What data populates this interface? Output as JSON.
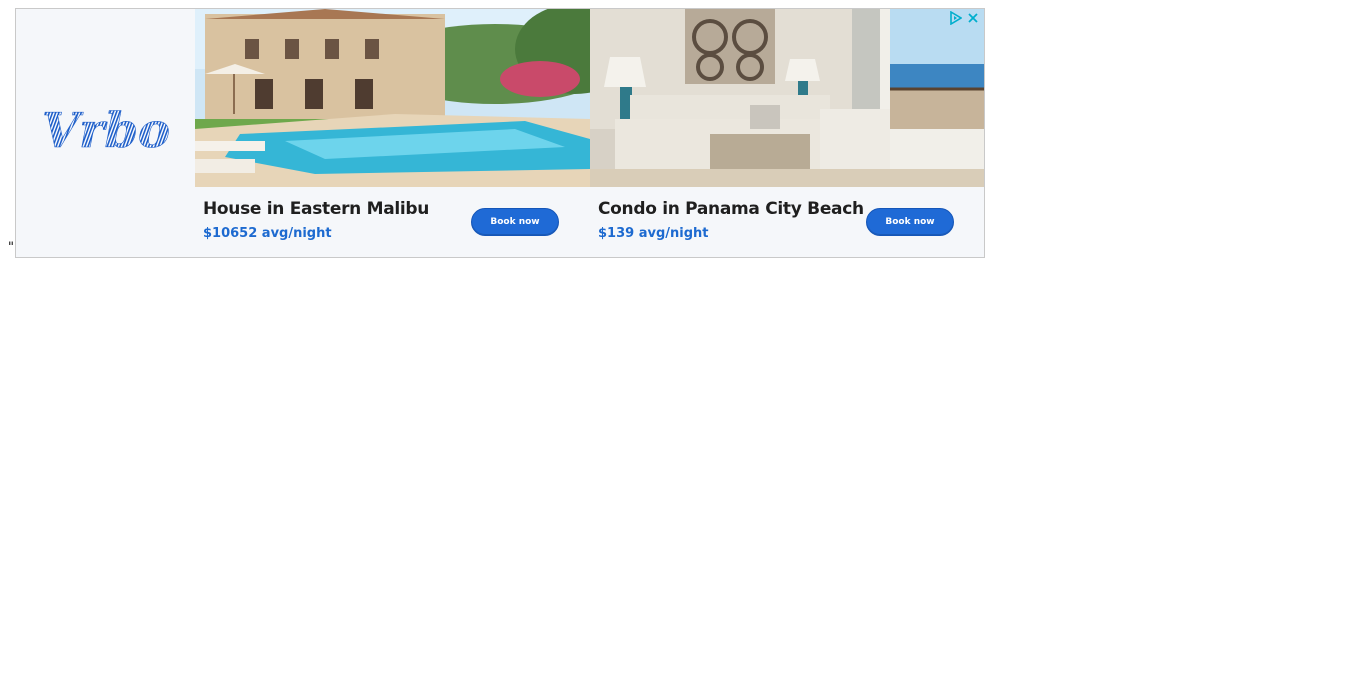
{
  "stray_text": "\"",
  "brand": {
    "name": "Vrbo",
    "logo_text": "Vrbo",
    "color": "#1d5ec9"
  },
  "ad_controls": {
    "adchoices_icon": "adchoices-triangle-icon",
    "close_icon": "close-x-icon",
    "accent": "#00aecd"
  },
  "listings": [
    {
      "title": "House in Eastern Malibu",
      "price": "$10652 avg/night",
      "button_label": "Book now",
      "photo": "villa-with-pool"
    },
    {
      "title": "Condo in Panama City Beach",
      "price": "$139 avg/night",
      "button_label": "Book now",
      "photo": "living-room-ocean-view"
    }
  ],
  "colors": {
    "price": "#1d6ad0",
    "button": "#1f6ad6",
    "panel_bg": "#f5f7fa"
  }
}
